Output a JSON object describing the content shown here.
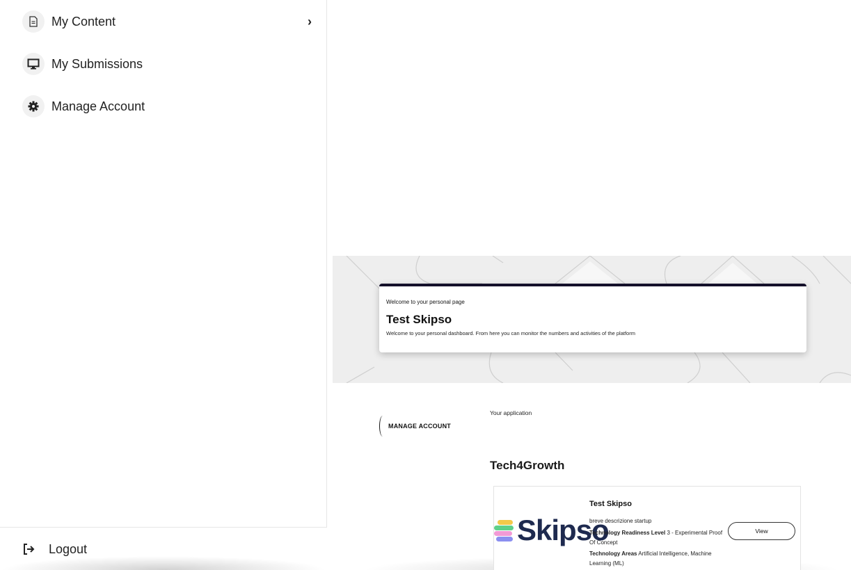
{
  "sidebar": {
    "items": [
      {
        "label": "My Content",
        "icon": "document-icon"
      },
      {
        "label": "My Submissions",
        "icon": "monitor-icon"
      },
      {
        "label": "Manage Account",
        "icon": "gear-icon"
      }
    ],
    "logout_label": "Logout",
    "logout_icon": "logout-icon"
  },
  "hero": {
    "subtitle": "Welcome to your personal page",
    "title": "Test Skipso",
    "description": "Welcome to your personal dashboard. From here you can monitor the numbers and activities of the platform"
  },
  "main": {
    "manage_account_label": "MANAGE ACCOUNT",
    "your_application_label": "Your application",
    "program_title": "Tech4Growth",
    "application": {
      "logo_text": "Skipso",
      "logo_colors": [
        "#f4c94a",
        "#5fd08a",
        "#f29ad6",
        "#8b8ff0"
      ],
      "name": "Test Skipso",
      "description": "breve descrizione startup",
      "trl_label": "Technology Readiness Level",
      "trl_value": "3 - Experimental Proof Of Concept",
      "areas_label": "Technology Areas",
      "areas_value": "Artificial Intelligence, Machine Learning (ML)",
      "view_button": "View"
    }
  },
  "colors": {
    "card_top_border": "#14102a",
    "logo_text": "#1e2a4f",
    "hero_background": "#eeeeee"
  }
}
